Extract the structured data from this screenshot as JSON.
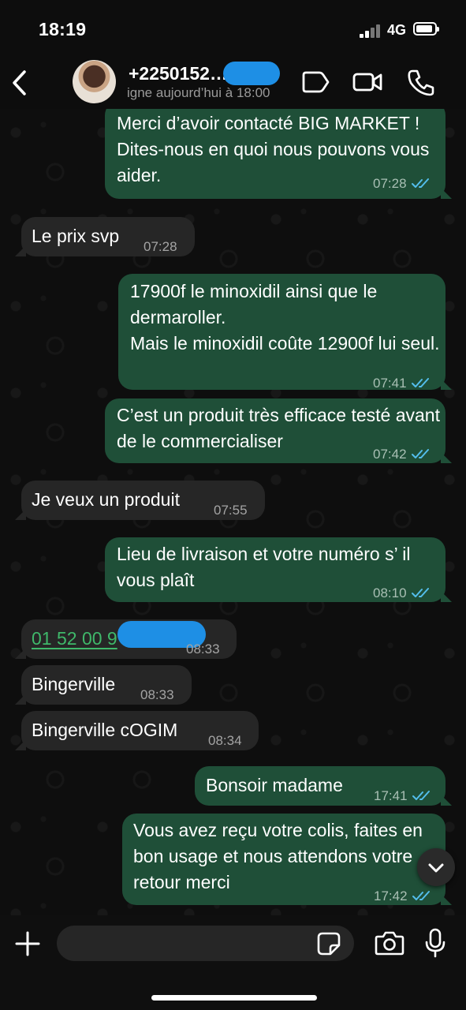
{
  "status_bar": {
    "time": "18:19",
    "network": "4G"
  },
  "header": {
    "contact_name": "+2250152…",
    "status": "igne aujourd’hui à 18:00"
  },
  "messages": [
    {
      "direction": "out",
      "text": "Merci d’avoir contacté BIG MARKET ! Dites-nous en quoi nous pouvons vous aider.",
      "time": "07:28",
      "read": true
    },
    {
      "direction": "in",
      "text": "Le prix svp",
      "time": "07:28"
    },
    {
      "direction": "out",
      "text": "17900f le minoxidil ainsi que le dermaroller.\nMais le minoxidil coûte 12900f lui seul.",
      "time": "07:41",
      "read": true
    },
    {
      "direction": "out",
      "text": "C’est un produit très efficace testé avant de le commercialiser",
      "time": "07:42",
      "read": true
    },
    {
      "direction": "in",
      "text": "Je veux un produit",
      "time": "07:55"
    },
    {
      "direction": "out",
      "text": "Lieu de livraison et votre numéro s’ il vous plaît",
      "time": "08:10",
      "read": true
    },
    {
      "direction": "in",
      "text": "01 52 00 9",
      "time": "08:33",
      "is_phone_link": true
    },
    {
      "direction": "in",
      "text": "Bingerville",
      "time": "08:33"
    },
    {
      "direction": "in",
      "text": "Bingerville cOGIM",
      "time": "08:34"
    },
    {
      "direction": "out",
      "text": "Bonsoir madame",
      "time": "17:41",
      "read": true
    },
    {
      "direction": "out",
      "text": "Vous avez reçu votre colis, faites en bon usage et nous attendons votre retour merci",
      "time": "17:42",
      "read": true
    }
  ],
  "composer": {
    "placeholder": ""
  },
  "colors": {
    "outgoing_bubble": "#1f4f38",
    "incoming_bubble": "#262626",
    "read_ticks": "#53bdeb",
    "phone_link": "#3fb86a",
    "redaction": "#1e8fe5"
  },
  "icons": {
    "back": "chevron-left-icon",
    "label": "label-tag-icon",
    "video": "video-camera-icon",
    "call": "phone-icon",
    "add": "plus-icon",
    "sticker": "sticker-icon",
    "camera": "camera-icon",
    "mic": "microphone-icon",
    "scroll": "chevron-down-icon"
  }
}
